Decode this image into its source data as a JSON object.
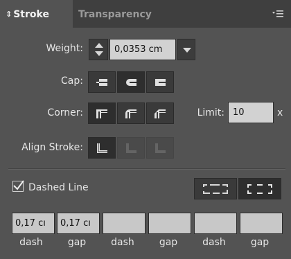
{
  "panel": {
    "tabs": [
      {
        "label": "Stroke",
        "icon": "updown-arrows-icon",
        "active": true
      },
      {
        "label": "Transparency",
        "active": false
      }
    ],
    "menu_icon": "panel-menu-icon"
  },
  "weight": {
    "label": "Weight:",
    "value": "0,0353 cm"
  },
  "cap": {
    "label": "Cap:",
    "options": [
      "butt-cap-icon",
      "round-cap-icon",
      "projecting-cap-icon"
    ],
    "selected": "round-cap-icon"
  },
  "corner": {
    "label": "Corner:",
    "options": [
      "miter-join-icon",
      "round-join-icon",
      "bevel-join-icon"
    ],
    "selected": "miter-join-icon"
  },
  "limit": {
    "label": "Limit:",
    "value": "10",
    "suffix": "x"
  },
  "align": {
    "label": "Align Stroke:",
    "options": [
      "align-center-icon",
      "align-inside-icon",
      "align-outside-icon"
    ],
    "selected": "align-center-icon"
  },
  "dashed": {
    "label": "Dashed Line",
    "checked": true,
    "modes": [
      "preserve-dash-icon",
      "align-dash-corners-icon"
    ],
    "fields": [
      {
        "value": "0,17 cı",
        "label": "dash"
      },
      {
        "value": "0,17 cı",
        "label": "gap"
      },
      {
        "value": "",
        "label": "dash"
      },
      {
        "value": "",
        "label": "gap"
      },
      {
        "value": "",
        "label": "dash"
      },
      {
        "value": "",
        "label": "gap"
      }
    ]
  },
  "colors": {
    "panel_bg": "#535353",
    "header_bg": "#3f3f3f",
    "field_bg": "#d2d2d2",
    "button_bg": "#3a3a3a"
  }
}
